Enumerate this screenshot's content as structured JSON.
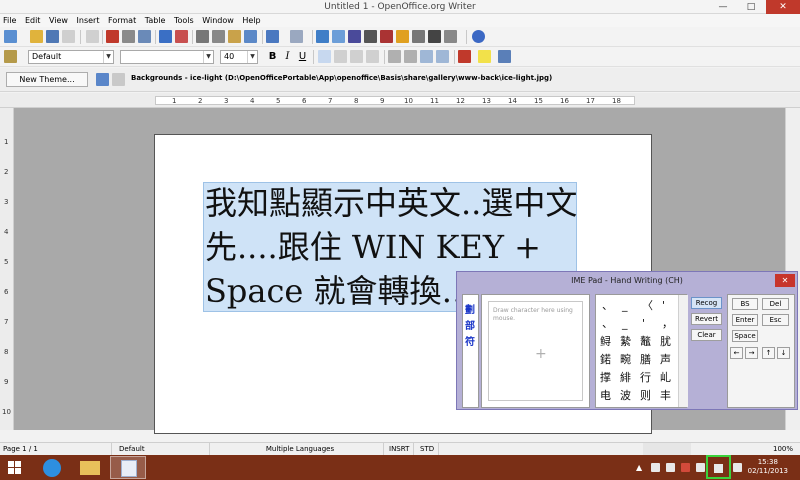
{
  "window": {
    "title": "Untitled 1 - OpenOffice.org Writer",
    "minimize": "—",
    "maximize": "□",
    "close": "✕"
  },
  "menu": [
    "File",
    "Edit",
    "View",
    "Insert",
    "Format",
    "Table",
    "Tools",
    "Window",
    "Help"
  ],
  "format_toolbar": {
    "style": "Default",
    "font": "",
    "size": "40",
    "bold": "B",
    "italic": "I",
    "underline": "U"
  },
  "gallery": {
    "new_theme": "New Theme...",
    "path": "Backgrounds - ice-light (D:\\OpenOfficePortable\\App\\openoffice\\Basis\\share\\gallery\\www-back\\ice-light.jpg)"
  },
  "ruler": {
    "numbers": [
      "1",
      "2",
      "3",
      "4",
      "5",
      "6",
      "7",
      "8",
      "9",
      "10",
      "11",
      "12",
      "13",
      "14",
      "15",
      "16",
      "17",
      "18"
    ]
  },
  "vruler": {
    "numbers": [
      "1",
      "2",
      "3",
      "4",
      "5",
      "6",
      "7",
      "8",
      "9",
      "10"
    ]
  },
  "document": {
    "lines": [
      "我知點顯示中英文..選中文",
      "先....跟住 WIN KEY +",
      "Space 就會轉換…"
    ]
  },
  "ime_pad": {
    "title": "IME Pad - Hand Writing (CH)",
    "close": "✕",
    "side_tabs": [
      "劃",
      "部",
      "符"
    ],
    "draw_hint": "Draw character here using mouse.",
    "plus": "+",
    "candidates": [
      "、",
      "_",
      "〈",
      "'",
      "、",
      "_",
      "'",
      "，",
      "鲟",
      "縶",
      "鼇",
      "肬",
      "鍩",
      "畹",
      "膳",
      "声",
      "撑",
      "緋",
      "行",
      "乢",
      "电",
      "波",
      "则",
      "丰"
    ],
    "buttons": {
      "recog": "Recog",
      "revert": "Revert",
      "clear": "Clear",
      "bs": "BS",
      "del": "Del",
      "enter": "Enter",
      "esc": "Esc",
      "space": "Space",
      "left": "←",
      "right": "→",
      "up": "↑",
      "down": "↓"
    }
  },
  "statusbar": {
    "page": "Page 1 / 1",
    "style": "Default",
    "language": "Multiple Languages",
    "mode": "INSRT",
    "selection": "STD",
    "zoom": "100%"
  },
  "taskbar": {
    "time": "15:38",
    "date": "02/11/2013"
  },
  "colors": {
    "taskbar": "#7a2f16",
    "selection": "#cfe3f7",
    "ime_frame": "#b5b0d6",
    "close_red": "#c0392b",
    "highlight_green": "#3bd23b"
  }
}
